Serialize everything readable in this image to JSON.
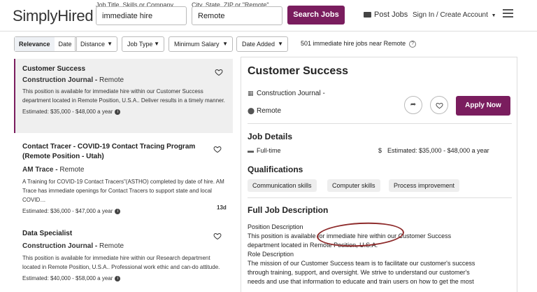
{
  "header": {
    "logo": "SimplyHired",
    "job_title_label": "Job Title, Skills or Company",
    "job_title_value": "immediate hire",
    "location_label": "City, State, ZIP or \"Remote\"",
    "location_value": "Remote",
    "search_label": "Search Jobs",
    "post_jobs_label": "Post Jobs",
    "signin_label": "Sign In / Create Account"
  },
  "filters": {
    "sort_relevance": "Relevance",
    "sort_date": "Date",
    "distance": "Distance",
    "job_type": "Job Type",
    "min_salary": "Minimum Salary",
    "date_added": "Date Added",
    "result_count": "501 immediate hire jobs near Remote"
  },
  "jobs": [
    {
      "title": "Customer Success",
      "company": "Construction Journal",
      "location": "Remote",
      "desc": "This position is available for immediate hire within our Customer Success department located in Remote Position, U.S.A.. Deliver results in a timely manner.",
      "salary": "Estimated: $35,000 - $48,000 a year",
      "age": ""
    },
    {
      "title": "Contact Tracer - COVID-19 Contact Tracing Program (Remote Position - Utah)",
      "company": "AM Trace",
      "location": "Remote",
      "desc": "A Training for COVID-19 Contact Tracers\"(ASTHO) completed by date of hire. AM Trace has immediate openings for Contact Tracers to support state and local COVID…",
      "salary": "Estimated: $36,000 - $47,000 a year",
      "age": "13d"
    },
    {
      "title": "Data Specialist",
      "company": "Construction Journal",
      "location": "Remote",
      "desc": "This position is available for immediate hire within our Research department located in Remote Position, U.S.A.. Professional work ethic and can-do attitude.",
      "salary": "Estimated: $40,000 - $58,000 a year",
      "age": ""
    }
  ],
  "detail": {
    "title": "Customer Success",
    "company": "Construction Journal -",
    "location": "Remote",
    "apply_label": "Apply Now",
    "job_details_heading": "Job Details",
    "job_type": "Full-time",
    "salary": "Estimated: $35,000 - $48,000 a year",
    "qualifications_heading": "Qualifications",
    "qualifications": [
      "Communication skills",
      "Computer skills",
      "Process improvement"
    ],
    "full_desc_heading": "Full Job Description",
    "desc_lines": [
      "Position Description",
      "This position is available for immediate hire within our Customer Success",
      "department located in Remote Position, U.S.A.",
      "Role Description",
      "The mission of our Customer Success team is to facilitate our customer's success",
      "through training, support, and oversight. We strive to understand our customer's",
      "needs and use that information to educate and train users on how to get the most"
    ]
  },
  "colors": {
    "brand": "#7a1d5e",
    "annotation": "#8e2b2b"
  },
  "icons": [
    "briefcase-icon",
    "menu-icon",
    "help-icon",
    "heart-icon",
    "info-icon",
    "building-icon",
    "location-pin-icon",
    "share-icon",
    "dollar-icon"
  ]
}
